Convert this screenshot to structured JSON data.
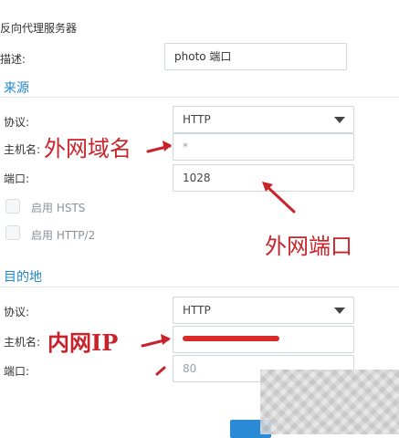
{
  "dialog": {
    "title": "反向代理服务器"
  },
  "fields": {
    "description_label": "描述:",
    "description_value": "photo 端口"
  },
  "source": {
    "heading": "来源",
    "protocol_label": "协议:",
    "protocol_value": "HTTP",
    "hostname_label": "主机名:",
    "hostname_value": "*",
    "port_label": "端口:",
    "port_value": "1028",
    "hsts_label": "启用 HSTS",
    "http2_label": "启用 HTTP/2"
  },
  "destination": {
    "heading": "目的地",
    "protocol_label": "协议:",
    "protocol_value": "HTTP",
    "hostname_label": "主机名:",
    "port_label": "端口:",
    "port_value": "80"
  },
  "annotations": {
    "external_domain": "外网域名",
    "external_port": "外网端口",
    "internal_ip": "内网IP"
  },
  "colors": {
    "accent": "#1e88c8",
    "annotation": "#c8232b",
    "button": "#2b8ad6"
  }
}
